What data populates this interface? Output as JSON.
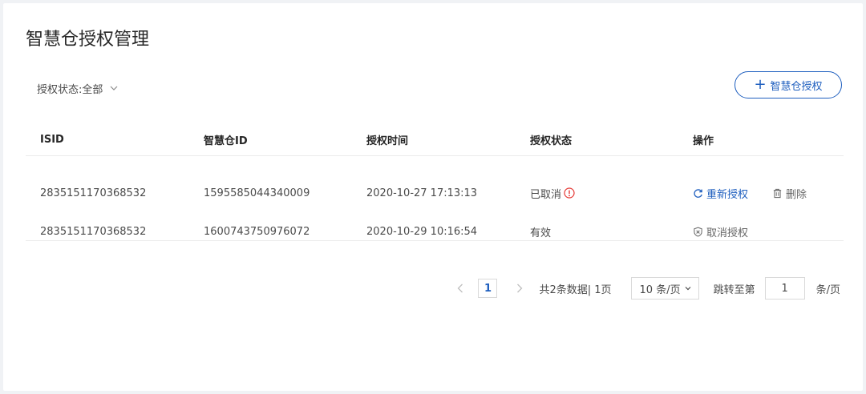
{
  "page": {
    "title": "智慧仓授权管理"
  },
  "filter": {
    "label": "授权状态:",
    "value": "全部"
  },
  "add_button": {
    "label": "智慧仓授权"
  },
  "table": {
    "headers": [
      "ISID",
      "智慧仓ID",
      "授权时间",
      "授权状态",
      "操作"
    ],
    "rows": [
      {
        "isid": "2835151170368532",
        "warehouse_id": "1595585044340009",
        "time": "2020-10-27 17:13:13",
        "status": "已取消",
        "actions": [
          "重新授权",
          "删除"
        ]
      },
      {
        "isid": "2835151170368532",
        "warehouse_id": "1600743750976072",
        "time": "2020-10-29 10:16:54",
        "status": "有效",
        "actions": [
          "取消授权"
        ]
      }
    ]
  },
  "pagination": {
    "current_page": "1",
    "summary": "共2条数据| 1页",
    "page_size": "10 条/页",
    "jump_label": "跳转至第",
    "jump_value": "1",
    "jump_suffix": "条/页"
  },
  "colors": {
    "accent": "#1f5fbf",
    "warning": "#e53935",
    "text": "#4a4a4a",
    "border": "#d9d9d9"
  },
  "icons": [
    "chevron-down-icon",
    "plus-icon",
    "warning-icon",
    "refresh-icon",
    "trash-icon",
    "cancel-icon",
    "chevron-left-icon",
    "chevron-right-icon"
  ]
}
